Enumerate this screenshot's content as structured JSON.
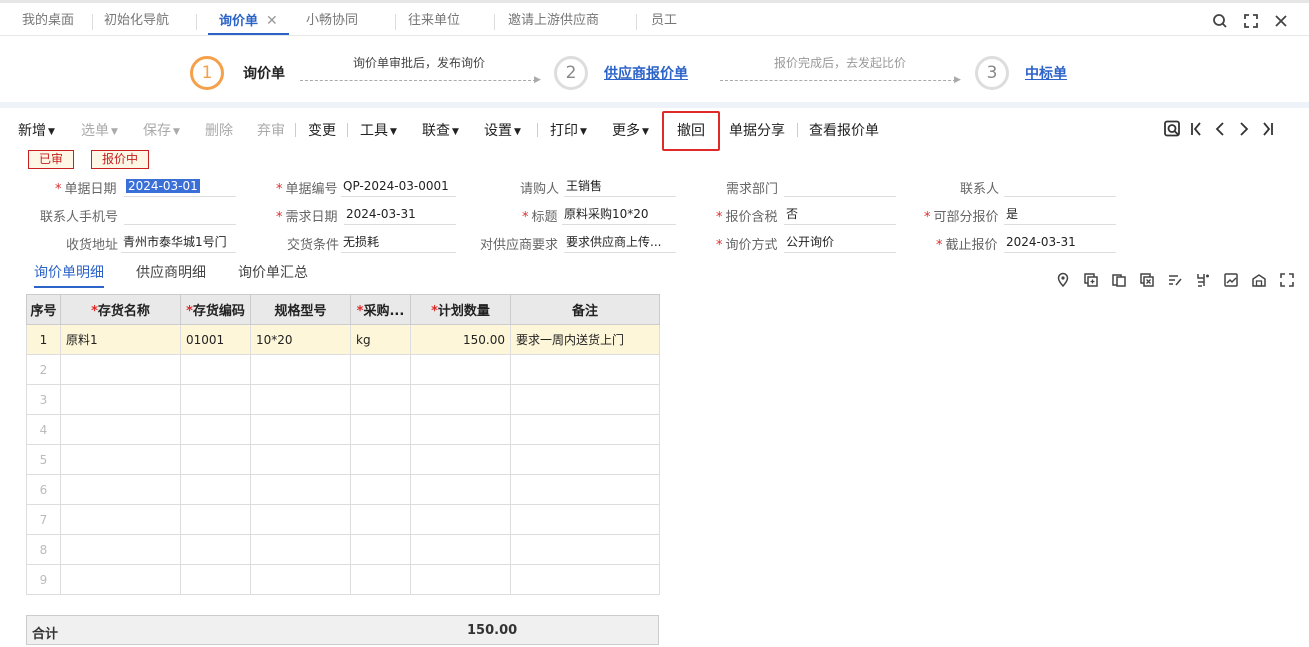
{
  "tabs": [
    {
      "label": "我的桌面"
    },
    {
      "label": "初始化导航"
    },
    {
      "label": "询价单",
      "active": true
    },
    {
      "label": "小畅协同"
    },
    {
      "label": "往来单位"
    },
    {
      "label": "邀请上游供应商"
    },
    {
      "label": "员工"
    }
  ],
  "tab_close": "✕",
  "steps": {
    "s1": {
      "num": "1",
      "label": "询价单"
    },
    "hint1": "询价单审批后，发布询价",
    "s2": {
      "num": "2",
      "label": "供应商报价单"
    },
    "hint2": "报价完成后，去发起比价",
    "s3": {
      "num": "3",
      "label": "中标单"
    }
  },
  "toolbar": {
    "new": "新增",
    "select": "选单",
    "save": "保存",
    "delete": "删除",
    "abandon": "弃审",
    "change": "变更",
    "tools": "工具",
    "lookup": "联查",
    "settings": "设置",
    "print": "打印",
    "more": "更多",
    "revoke": "撤回",
    "share": "单据分享",
    "view_quotes": "查看报价单"
  },
  "badges": {
    "approved": "已审",
    "quoting": "报价中"
  },
  "form": {
    "doc_date_label": "单据日期",
    "doc_date": "2024-03-01",
    "doc_no_label": "单据编号",
    "doc_no": "QP-2024-03-0001",
    "requester_label": "请购人",
    "requester": "王销售",
    "dept_label": "需求部门",
    "dept": "",
    "contact_label": "联系人",
    "contact": "",
    "phone_label": "联系人手机号",
    "phone": "",
    "need_date_label": "需求日期",
    "need_date": "2024-03-31",
    "title_label": "标题",
    "title": "原料采购10*20",
    "tax_label": "报价含税",
    "tax": "否",
    "partial_label": "可部分报价",
    "partial": "是",
    "addr_label": "收货地址",
    "addr": "青州市泰华城1号门",
    "terms_label": "交货条件",
    "terms": "无损耗",
    "req_label": "对供应商要求",
    "req": "要求供应商上传...",
    "method_label": "询价方式",
    "method": "公开询价",
    "deadline_label": "截止报价",
    "deadline": "2024-03-31"
  },
  "subtabs": {
    "detail": "询价单明细",
    "suppliers": "供应商明细",
    "summary": "询价单汇总"
  },
  "grid": {
    "headers": {
      "seq": "序号",
      "name": "存货名称",
      "code": "存货编码",
      "spec": "规格型号",
      "unit": "采购...",
      "qty": "计划数量",
      "note": "备注"
    },
    "rows": [
      {
        "seq": "1",
        "name": "原料1",
        "code": "01001",
        "spec": "10*20",
        "unit": "kg",
        "qty": "150.00",
        "note": "要求一周内送货上门"
      },
      {
        "seq": "2"
      },
      {
        "seq": "3"
      },
      {
        "seq": "4"
      },
      {
        "seq": "5"
      },
      {
        "seq": "6"
      },
      {
        "seq": "7"
      },
      {
        "seq": "8"
      },
      {
        "seq": "9"
      }
    ]
  },
  "total": {
    "label": "合计",
    "value": "150.00"
  }
}
